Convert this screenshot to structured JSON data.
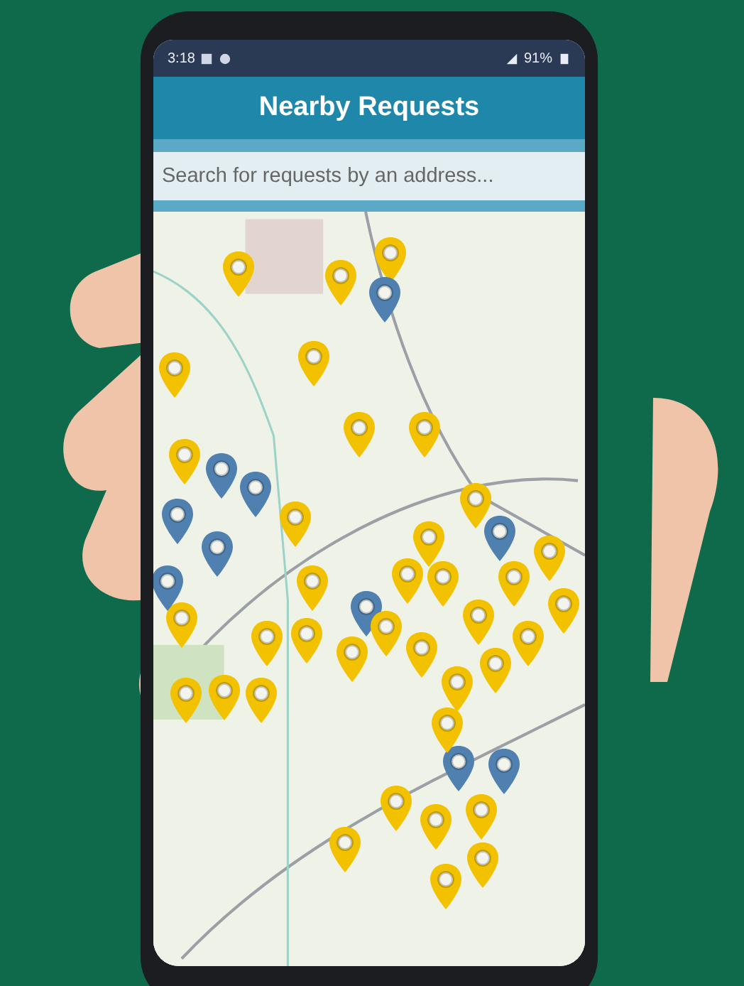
{
  "status_bar": {
    "time": "3:18",
    "battery": "91%"
  },
  "header": {
    "title": "Nearby Requests"
  },
  "search": {
    "placeholder": "Search for requests by an address..."
  },
  "pins": [
    {
      "color": "#f2c200"
    },
    {
      "color": "#f2c200"
    },
    {
      "color": "#f2c200"
    },
    {
      "color": "#4f80b0"
    },
    {
      "color": "#f2c200"
    },
    {
      "color": "#f2c200"
    },
    {
      "color": "#f2c200"
    },
    {
      "color": "#f2c200"
    },
    {
      "color": "#f2c200"
    },
    {
      "color": "#4f80b0"
    },
    {
      "color": "#4f80b0"
    },
    {
      "color": "#4f80b0"
    },
    {
      "color": "#4f80b0"
    },
    {
      "color": "#f2c200"
    },
    {
      "color": "#f2c200"
    },
    {
      "color": "#f2c200"
    },
    {
      "color": "#4f80b0"
    },
    {
      "color": "#f2c200"
    },
    {
      "color": "#4f80b0"
    },
    {
      "color": "#f2c200"
    },
    {
      "color": "#f2c200"
    },
    {
      "color": "#f2c200"
    },
    {
      "color": "#f2c200"
    },
    {
      "color": "#f2c200"
    },
    {
      "color": "#f2c200"
    },
    {
      "color": "#f2c200"
    },
    {
      "color": "#4f80b0"
    },
    {
      "color": "#f2c200"
    },
    {
      "color": "#f2c200"
    },
    {
      "color": "#f2c200"
    },
    {
      "color": "#f2c200"
    },
    {
      "color": "#f2c200"
    },
    {
      "color": "#f2c200"
    },
    {
      "color": "#f2c200"
    },
    {
      "color": "#f2c200"
    },
    {
      "color": "#4f80b0"
    },
    {
      "color": "#4f80b0"
    },
    {
      "color": "#f2c200"
    },
    {
      "color": "#f2c200"
    },
    {
      "color": "#f2c200"
    },
    {
      "color": "#f2c200"
    },
    {
      "color": "#f2c200"
    },
    {
      "color": "#f2c200"
    },
    {
      "color": "#f2c200"
    },
    {
      "color": "#f2c200"
    },
    {
      "color": "#f2c200"
    },
    {
      "color": "#f2c200"
    }
  ]
}
